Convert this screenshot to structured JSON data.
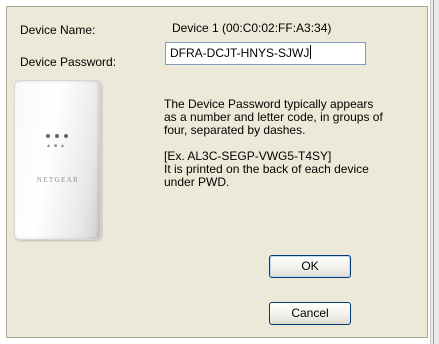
{
  "device_name": {
    "label": "Device Name:",
    "value": "Device 1   (00:C0:02:FF:A3:34)"
  },
  "device_password": {
    "label": "Device Password:",
    "value": "DFRA-DCJT-HNYS-SJWJ"
  },
  "device_image": {
    "brand": "NETGEAR",
    "icon": "powerline-adapter-icon"
  },
  "info": {
    "line1": "The Device Password typically appears",
    "line2": "as a number and letter code, in groups of",
    "line3": "four, separated by dashes.",
    "example": "[Ex. AL3C-SEGP-VWG5-T4SY]",
    "line5": "It is printed on the back of each device",
    "line6": "under PWD."
  },
  "buttons": {
    "ok": "OK",
    "cancel": "Cancel"
  }
}
